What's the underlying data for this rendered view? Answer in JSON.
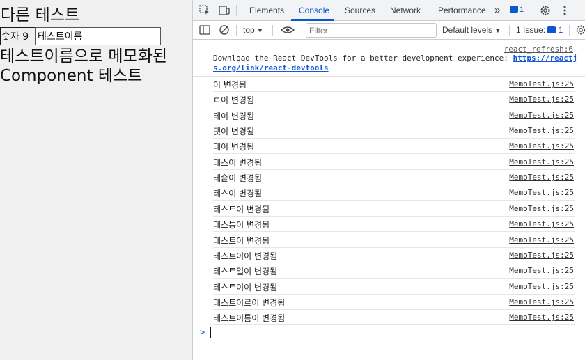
{
  "app": {
    "heading": "다른 테스트",
    "number_button": "숫자 9",
    "name_input_value": "테스트이름",
    "memo_text": "테스트이름으로 메모화된\nComponent 테스트"
  },
  "devtools": {
    "tabs": [
      {
        "label": "Elements"
      },
      {
        "label": "Console"
      },
      {
        "label": "Sources"
      },
      {
        "label": "Network"
      },
      {
        "label": "Performance"
      }
    ],
    "more_tabs": "»",
    "message_badge_count": "1",
    "toolbar": {
      "context": "top",
      "filter_placeholder": "Filter",
      "levels": "Default levels",
      "issues_label": "1 Issue:",
      "issues_count": "1"
    },
    "react_message": {
      "source": "react_refresh:6",
      "text": "Download the React DevTools for a better development experience: ",
      "link": "https://reactjs.org/link/react-devtools"
    },
    "logs": [
      {
        "text": "이 변경됨",
        "source": "MemoTest.js:25"
      },
      {
        "text": "ㅌ이 변경됨",
        "source": "MemoTest.js:25"
      },
      {
        "text": "테이 변경됨",
        "source": "MemoTest.js:25"
      },
      {
        "text": "텟이 변경됨",
        "source": "MemoTest.js:25"
      },
      {
        "text": "테이 변경됨",
        "source": "MemoTest.js:25"
      },
      {
        "text": "테스이 변경됨",
        "source": "MemoTest.js:25"
      },
      {
        "text": "테슽이 변경됨",
        "source": "MemoTest.js:25"
      },
      {
        "text": "테스이 변경됨",
        "source": "MemoTest.js:25"
      },
      {
        "text": "테스트이 변경됨",
        "source": "MemoTest.js:25"
      },
      {
        "text": "테스틍이 변경됨",
        "source": "MemoTest.js:25"
      },
      {
        "text": "테스트이 변경됨",
        "source": "MemoTest.js:25"
      },
      {
        "text": "테스트이이 변경됨",
        "source": "MemoTest.js:25"
      },
      {
        "text": "테스트일이 변경됨",
        "source": "MemoTest.js:25"
      },
      {
        "text": "테스트이이 변경됨",
        "source": "MemoTest.js:25"
      },
      {
        "text": "테스트이르이 변경됨",
        "source": "MemoTest.js:25"
      },
      {
        "text": "테스트이름이 변경됨",
        "source": "MemoTest.js:25"
      }
    ],
    "prompt_symbol": ">",
    "colors": {
      "accent": "#0b57d0",
      "tabbar_bg": "#f1f3f4"
    },
    "icons": [
      "inspect-element-icon",
      "device-toolbar-icon",
      "messages-icon",
      "settings-icon",
      "kebab-menu-icon",
      "sidebar-toggle-icon",
      "clear-console-icon",
      "live-expression-eye-icon"
    ]
  }
}
